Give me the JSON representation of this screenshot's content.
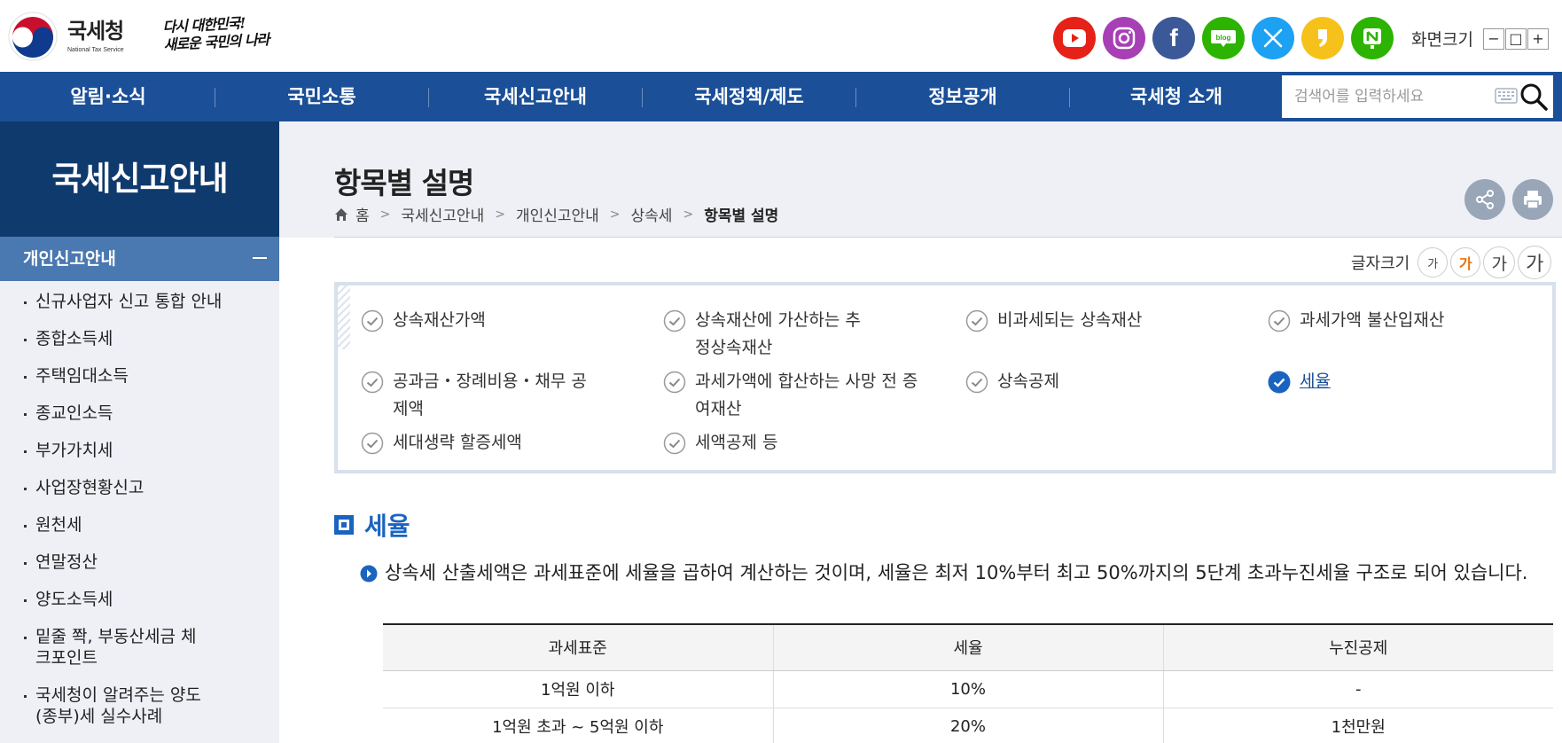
{
  "header": {
    "logo_name": "국세청",
    "logo_en": "National Tax Service",
    "slogan_line1": "다시 대한민국!",
    "slogan_line2": "새로운 국민의 나라",
    "sns": [
      "youtube-icon",
      "instagram-icon",
      "facebook-icon",
      "blog-icon",
      "x-icon",
      "kakao-story-icon",
      "naver-post-icon"
    ],
    "blog_label": "blog",
    "screen_size_label": "화면크기",
    "zoom_out": "−",
    "zoom_reset": "□",
    "zoom_in": "+"
  },
  "gnb": {
    "items": [
      "알림·소식",
      "국민소통",
      "국세신고안내",
      "국세정책/제도",
      "정보공개",
      "국세청 소개"
    ],
    "search_placeholder": "검색어를 입력하세요"
  },
  "sidebar": {
    "title": "국세신고안내",
    "category": "개인신고안내",
    "items": [
      "신규사업자 신고 통합 안내",
      "종합소득세",
      "주택임대소득",
      "종교인소득",
      "부가가치세",
      "사업장현황신고",
      "원천세",
      "연말정산",
      "양도소득세",
      "밑줄 쫙, 부동산세금 체크포인트",
      "국세청이 알려주는 양도(종부)세 실수사례"
    ]
  },
  "page": {
    "title": "항목별 설명",
    "breadcrumb": [
      "홈",
      "국세신고안내",
      "개인신고안내",
      "상속세",
      "항목별 설명"
    ],
    "font_size_label": "글자크기",
    "font_size_buttons": [
      "가",
      "가",
      "가",
      "가"
    ],
    "font_size_active_index": 1
  },
  "tabs": [
    {
      "label": "상속재산가액",
      "active": false
    },
    {
      "label": "상속재산에 가산하는 추정상속재산",
      "active": false
    },
    {
      "label": "비과세되는 상속재산",
      "active": false
    },
    {
      "label": "과세가액 불산입재산",
      "active": false
    },
    {
      "label": "공과금・장례비용・채무 공제액",
      "active": false
    },
    {
      "label": "과세가액에 합산하는 사망 전 증여재산",
      "active": false
    },
    {
      "label": "상속공제",
      "active": false
    },
    {
      "label": "세율",
      "active": true
    },
    {
      "label": "세대생략 할증세액",
      "active": false
    },
    {
      "label": "세액공제 등",
      "active": false
    }
  ],
  "section": {
    "title": "세율",
    "description": "상속세 산출세액은 과세표준에 세율을 곱하여 계산하는 것이며, 세율은 최저 10%부터 최고 50%까지의 5단계 초과누진세율 구조로 되어 있습니다."
  },
  "rate_table": {
    "headers": [
      "과세표준",
      "세율",
      "누진공제"
    ],
    "rows": [
      [
        "1억원 이하",
        "10%",
        "-"
      ],
      [
        "1억원 초과 ~ 5억원 이하",
        "20%",
        "1천만원"
      ]
    ]
  },
  "colors": {
    "gnb": "#1b4f97",
    "sidebar_title": "#0f3a6d",
    "sidebar_category": "#4a78b0",
    "accent_blue": "#1a64c0",
    "active_font": "#e8720c"
  }
}
